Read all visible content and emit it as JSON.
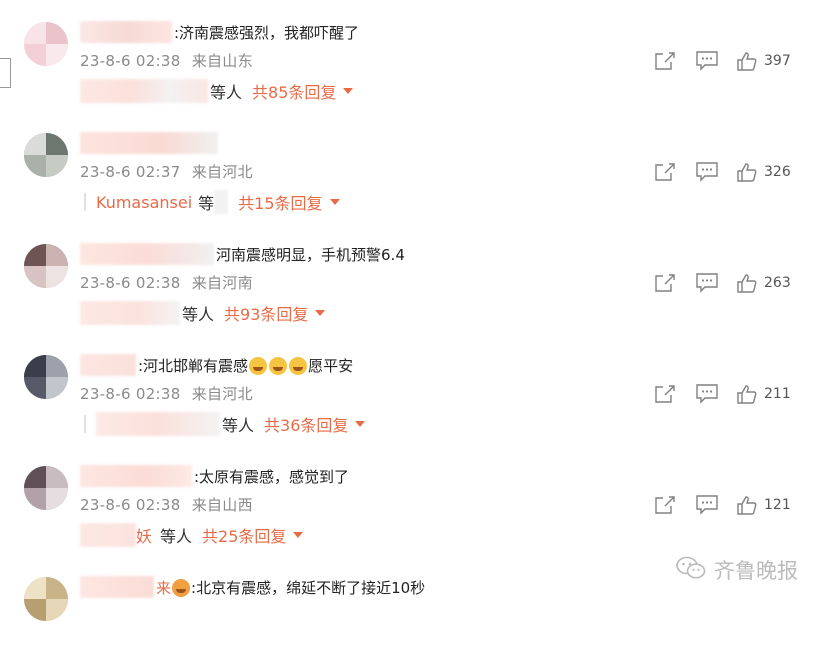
{
  "comments": [
    {
      "text": ":济南震感强烈，我都吓醒了",
      "date": "23-8-6 02:38",
      "location": "来自山东",
      "reply_suffix": "等人",
      "reply_count": "共85条回复",
      "likes": "397"
    },
    {
      "text": "",
      "date": "23-8-6 02:37",
      "location": "来自河北",
      "reply_name": "Kumasansei",
      "reply_suffix": "等",
      "reply_count": "共15条回复",
      "likes": "326"
    },
    {
      "text": "河南震感明显，手机预警6.4",
      "date": "23-8-6 02:38",
      "location": "来自河南",
      "reply_suffix": "等人",
      "reply_count": "共93条回复",
      "likes": "263"
    },
    {
      "text_before": ":河北邯郸有震感",
      "text_after": "愿平安",
      "date": "23-8-6 02:38",
      "location": "来自河北",
      "reply_suffix": "等人",
      "reply_count": "共36条回复",
      "likes": "211"
    },
    {
      "text": ":太原有震感，感觉到了",
      "date": "23-8-6 02:38",
      "location": "来自山西",
      "reply_name": "妖",
      "reply_suffix": "等人",
      "reply_count": "共25条回复",
      "likes": "121"
    },
    {
      "name_partial": "来",
      "text": ":北京有震感，绵延不断了接近10秒"
    }
  ],
  "watermark": {
    "label": "齐鲁晚报",
    "icon": "wechat-icon"
  },
  "icons": [
    "share-icon",
    "comment-icon",
    "like-icon",
    "caret-down-icon",
    "crying-emoji-icon"
  ],
  "colors": {
    "accent": "#e86b48",
    "meta": "#8a8a8a",
    "icon": "#808080"
  }
}
